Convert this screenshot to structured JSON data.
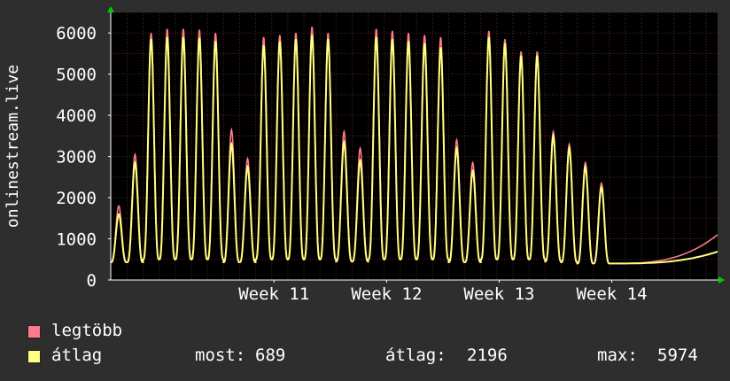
{
  "chart_data": {
    "type": "line",
    "ylabel": "onlinestream.live",
    "ylim": [
      0,
      6500
    ],
    "yticks": [
      0,
      1000,
      2000,
      3000,
      4000,
      5000,
      6000
    ],
    "xlim": [
      9.55,
      14.94
    ],
    "xticks": [
      {
        "label": "Week 11",
        "x": 11
      },
      {
        "label": "Week 12",
        "x": 12
      },
      {
        "label": "Week 13",
        "x": 13
      },
      {
        "label": "Week 14",
        "x": 14
      }
    ],
    "grid": true,
    "legend_position": "bottom",
    "days": [
      {
        "start": 9.55,
        "max": 1800,
        "avg": 1600,
        "min": 430
      },
      {
        "start": 9.694,
        "max": 3050,
        "avg": 2850,
        "min": 430
      },
      {
        "start": 9.837,
        "max": 6000,
        "avg": 5850,
        "min": 500
      },
      {
        "start": 9.98,
        "max": 6100,
        "avg": 5900,
        "min": 500
      },
      {
        "start": 10.123,
        "max": 6100,
        "avg": 5900,
        "min": 500
      },
      {
        "start": 10.266,
        "max": 6080,
        "avg": 5880,
        "min": 500
      },
      {
        "start": 10.409,
        "max": 6000,
        "avg": 5800,
        "min": 500
      },
      {
        "start": 10.551,
        "max": 3650,
        "avg": 3300,
        "min": 430
      },
      {
        "start": 10.694,
        "max": 2950,
        "avg": 2750,
        "min": 430
      },
      {
        "start": 10.837,
        "max": 5900,
        "avg": 5700,
        "min": 500
      },
      {
        "start": 10.98,
        "max": 5950,
        "avg": 5800,
        "min": 500
      },
      {
        "start": 11.123,
        "max": 6000,
        "avg": 5850,
        "min": 500
      },
      {
        "start": 11.266,
        "max": 6150,
        "avg": 5950,
        "min": 500
      },
      {
        "start": 11.409,
        "max": 6000,
        "avg": 5850,
        "min": 500
      },
      {
        "start": 11.551,
        "max": 3600,
        "avg": 3350,
        "min": 450
      },
      {
        "start": 11.694,
        "max": 3200,
        "avg": 2900,
        "min": 450
      },
      {
        "start": 11.837,
        "max": 6100,
        "avg": 5900,
        "min": 500
      },
      {
        "start": 11.98,
        "max": 6050,
        "avg": 5850,
        "min": 500
      },
      {
        "start": 12.123,
        "max": 6000,
        "avg": 5800,
        "min": 500
      },
      {
        "start": 12.266,
        "max": 5950,
        "avg": 5750,
        "min": 500
      },
      {
        "start": 12.409,
        "max": 5900,
        "avg": 5650,
        "min": 500
      },
      {
        "start": 12.551,
        "max": 3400,
        "avg": 3200,
        "min": 430
      },
      {
        "start": 12.694,
        "max": 2850,
        "avg": 2650,
        "min": 430
      },
      {
        "start": 12.837,
        "max": 6050,
        "avg": 5900,
        "min": 500
      },
      {
        "start": 12.98,
        "max": 5850,
        "avg": 5750,
        "min": 500
      },
      {
        "start": 13.123,
        "max": 5550,
        "avg": 5450,
        "min": 500
      },
      {
        "start": 13.266,
        "max": 5550,
        "avg": 5450,
        "min": 500
      },
      {
        "start": 13.409,
        "max": 3600,
        "avg": 3500,
        "min": 450
      },
      {
        "start": 13.551,
        "max": 3300,
        "avg": 3200,
        "min": 430
      },
      {
        "start": 13.694,
        "max": 2850,
        "avg": 2750,
        "min": 400
      },
      {
        "start": 13.837,
        "max": 2350,
        "avg": 2250,
        "min": 400
      }
    ],
    "tail": {
      "start": 13.98,
      "max": 1100,
      "avg": 689
    },
    "series": [
      {
        "name": "legtöbb",
        "color": "#ff7a8a"
      },
      {
        "name": "átlag",
        "color": "#ffff80"
      }
    ],
    "colors": {
      "background": "#000000",
      "grid": "#5a2424",
      "axis": "#ffffff",
      "arrow": "#00cc00"
    }
  },
  "stats": {
    "now_label": "most:",
    "now_value": "689",
    "avg_label": "átlag:",
    "avg_value": "2196",
    "max_label": "max:",
    "max_value": "5974"
  }
}
